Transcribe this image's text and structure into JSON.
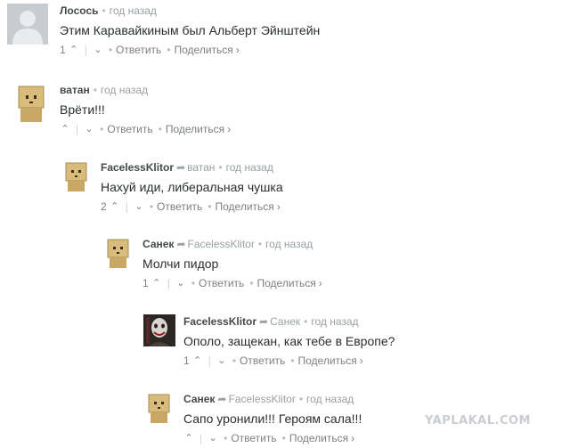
{
  "comments": [
    {
      "author": "Лосось",
      "time": "год назад",
      "text": "Этим Каравайкиным был Альберт Эйнштейн",
      "votes": "1",
      "reply_label": "Ответить",
      "share_label": "Поделиться",
      "avatar": "default-silhouette"
    },
    {
      "author": "ватан",
      "time": "год назад",
      "text": "Врёти!!!",
      "votes": "",
      "reply_label": "Ответить",
      "share_label": "Поделиться",
      "avatar": "cardboard-box-head"
    },
    {
      "author": "FacelessKlitor",
      "reply_to": "ватан",
      "time": "год назад",
      "text": "Нахуй иди, либеральная чушка",
      "votes": "2",
      "reply_label": "Ответить",
      "share_label": "Поделиться",
      "avatar": "cardboard-box-head"
    },
    {
      "author": "Санек",
      "reply_to": "FacelessKlitor",
      "time": "год назад",
      "text": "Молчи пидор",
      "votes": "1",
      "reply_label": "Ответить",
      "share_label": "Поделиться",
      "avatar": "cardboard-box-head"
    },
    {
      "author": "FacelessKlitor",
      "reply_to": "Санек",
      "time": "год назад",
      "text": "Ополо, защекан, как тебе в Европе?",
      "votes": "1",
      "reply_label": "Ответить",
      "share_label": "Поделиться",
      "avatar": "dark-photo"
    },
    {
      "author": "Санек",
      "reply_to": "FacelessKlitor",
      "time": "год назад",
      "text": "Сапо уронили!!! Героям сала!!!",
      "votes": "",
      "reply_label": "Ответить",
      "share_label": "Поделиться",
      "avatar": "cardboard-box-head"
    }
  ],
  "icons": {
    "reply_arrow": "➦",
    "upvote": "⌃",
    "downvote": "⌄",
    "chevron": "›"
  },
  "watermark": "YAPLAKAL.COM"
}
